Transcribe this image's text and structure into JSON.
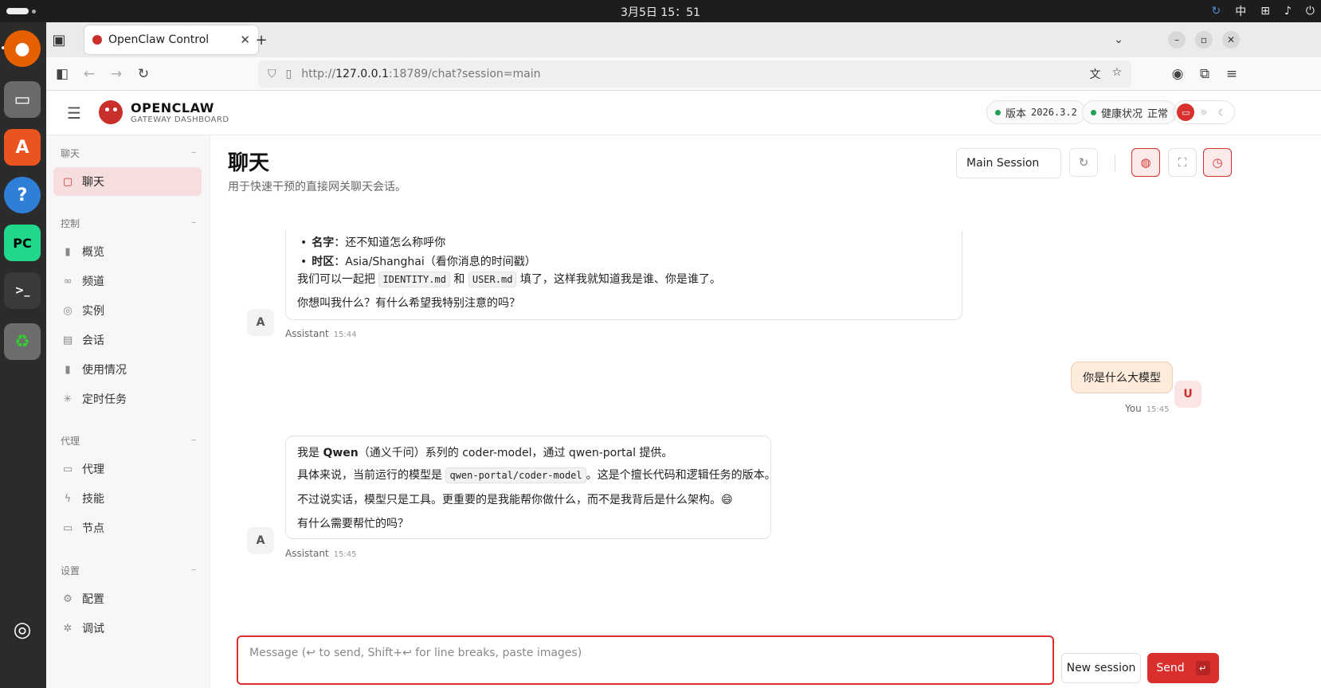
{
  "os": {
    "clock": "3月5日  15：51",
    "ime": "中"
  },
  "browser": {
    "tab_title": "OpenClaw Control",
    "url_prefix": "http://",
    "url_host": "127.0.0.1",
    "url_rest": ":18789/chat?session=main"
  },
  "app": {
    "brand_title": "OPENCLAW",
    "brand_subtitle": "GATEWAY DASHBOARD",
    "version_label": "版本",
    "version_value": "2026.3.2",
    "health_label": "健康状况",
    "health_value": "正常"
  },
  "sidebar": {
    "sections": [
      {
        "title": "聊天",
        "items": [
          {
            "label": "聊天"
          }
        ]
      },
      {
        "title": "控制",
        "items": [
          {
            "label": "概览"
          },
          {
            "label": "频道"
          },
          {
            "label": "实例"
          },
          {
            "label": "会话"
          },
          {
            "label": "使用情况"
          },
          {
            "label": "定时任务"
          }
        ]
      },
      {
        "title": "代理",
        "items": [
          {
            "label": "代理"
          },
          {
            "label": "技能"
          },
          {
            "label": "节点"
          }
        ]
      },
      {
        "title": "设置",
        "items": [
          {
            "label": "配置"
          },
          {
            "label": "调试"
          }
        ]
      }
    ],
    "collapse": "–"
  },
  "page": {
    "title": "聊天",
    "subtitle": "用于快速干预的直接网关聊天会话。",
    "session_select": "Main Session"
  },
  "messages": [
    {
      "role": "Assistant",
      "avatar": "A",
      "time": "15:44",
      "name_label": "名字",
      "name_text": "：还不知道怎么称呼你",
      "tz_label": "时区",
      "tz_text": "：Asia/Shanghai（看你消息的时间戳）",
      "fill_pre": "我们可以一起把",
      "fill_code1": "IDENTITY.md",
      "fill_mid": "和",
      "fill_code2": "USER.md",
      "fill_post": "填了，这样我就知道我是谁、你是谁了。",
      "ask": "你想叫我什么？有什么希望我特别注意的吗？"
    },
    {
      "role": "You",
      "avatar": "U",
      "time": "15:45",
      "text": "你是什么大模型"
    },
    {
      "role": "Assistant",
      "avatar": "A",
      "time": "15:45",
      "l1_pre": "我是",
      "l1_bold": "Qwen",
      "l1_post": "（通义千问）系列的 coder-model，通过 qwen-portal 提供。",
      "l2_pre": "具体来说，当前运行的模型是",
      "l2_code": "qwen-portal/coder-model",
      "l2_post": "。这是个擅长代码和逻辑任务的版本。",
      "l3": "不过说实话，模型只是工具。更重要的是我能帮你做什么，而不是我背后是什么架构。😄",
      "l4": "有什么需要帮忙的吗？"
    }
  ],
  "composer": {
    "placeholder": "Message (↩ to send, Shift+↩ for line breaks, paste images)",
    "new_session": "New session",
    "send": "Send",
    "send_key": "↵"
  }
}
